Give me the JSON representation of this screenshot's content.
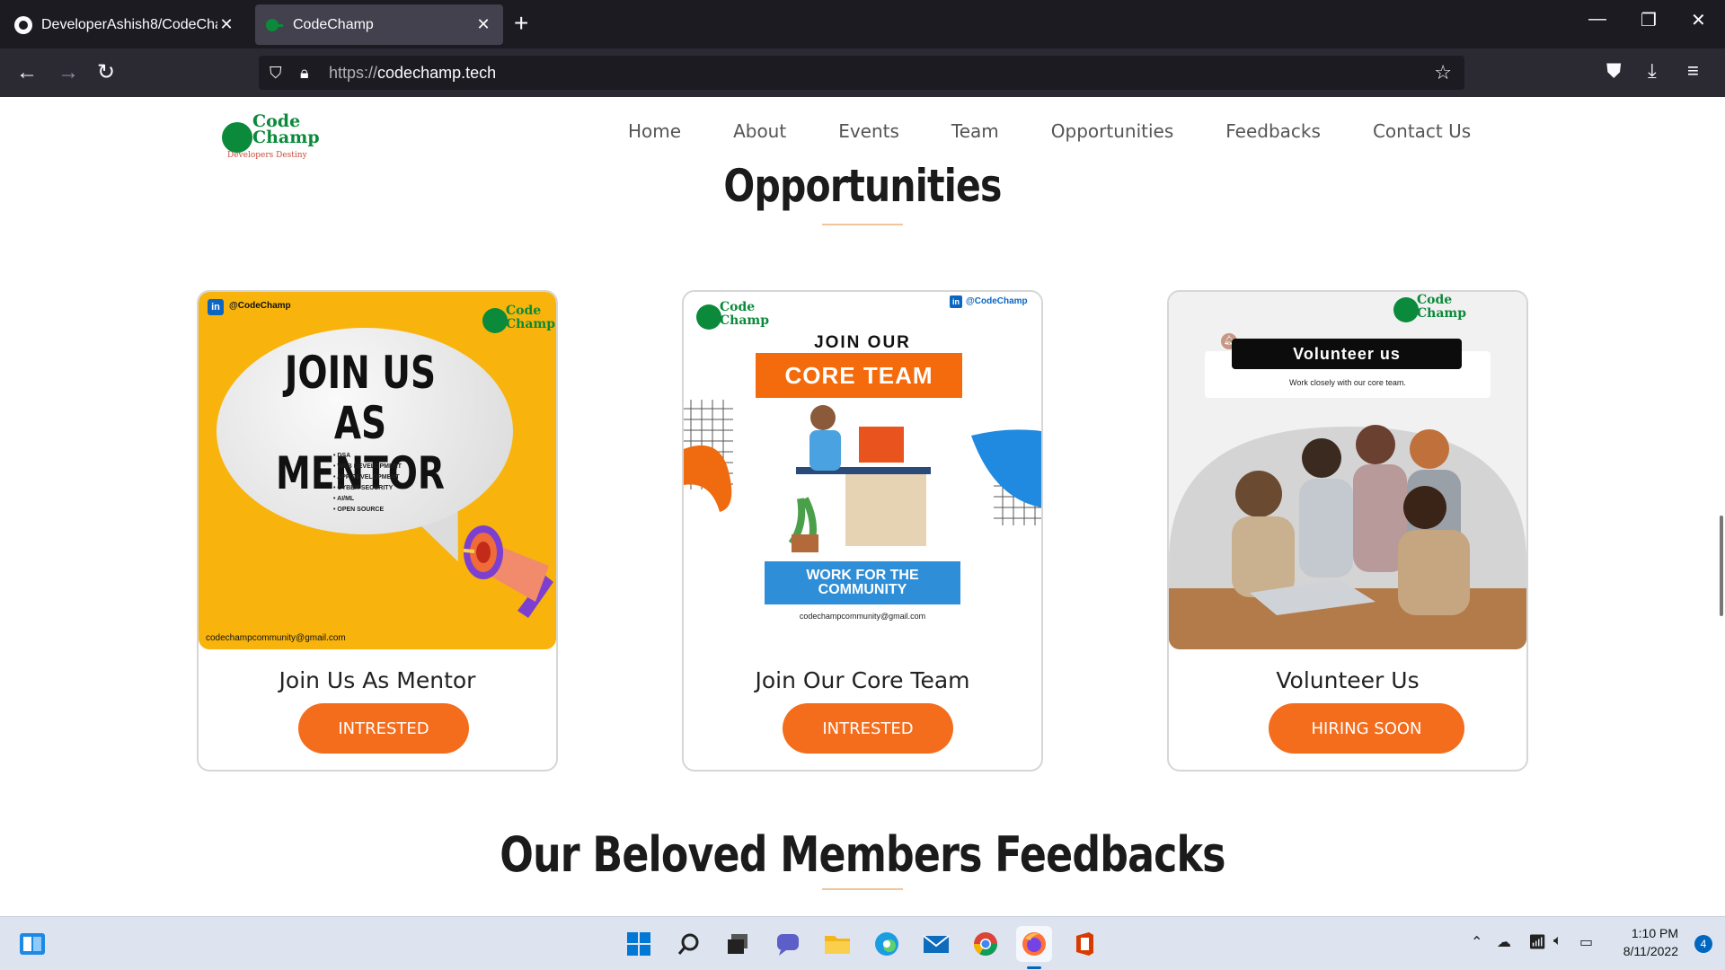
{
  "browser": {
    "tabs": [
      {
        "title": "DeveloperAshish8/CodeChamp",
        "close": "✕",
        "icon": "github-icon"
      },
      {
        "title": "CodeChamp",
        "close": "✕",
        "icon": "codechamp-favicon"
      }
    ],
    "new_tab": "+",
    "url_scheme": "https://",
    "url_host": "codechamp.tech",
    "window_controls": {
      "minimize": "—",
      "restore": "❐",
      "close": "✕"
    }
  },
  "site": {
    "logo": {
      "line1": "Code",
      "line2": "Champ",
      "tagline": "Developers Destiny"
    },
    "nav": [
      "Home",
      "About",
      "Events",
      "Team",
      "Opportunities",
      "Feedbacks",
      "Contact Us"
    ]
  },
  "opportunities": {
    "title": "Opportunities",
    "cards": [
      {
        "title": "Join Us As Mentor",
        "button": "INTRESTED",
        "poster": {
          "handle": "@CodeChamp",
          "headline": "JOIN US AS MENTOR",
          "bullets": [
            "• DSA",
            "• WEB DEVELOPMENT",
            "• APP DEVELOPMENT",
            "• CYBER SECURITY",
            "• AI/ML",
            "• OPEN SOURCE"
          ],
          "email": "codechampcommunity@gmail.com"
        }
      },
      {
        "title": "Join Our Core Team",
        "button": "INTRESTED",
        "poster": {
          "handle": "@CodeChamp",
          "join": "JOIN OUR",
          "core": "CORE TEAM",
          "work": "WORK FOR THE COMMUNITY",
          "email": "codechampcommunity@gmail.com"
        }
      },
      {
        "title": "Volunteer Us",
        "button": "HIRING SOON",
        "poster": {
          "heading": "Volunteer us",
          "sub": "Work closely with our core team."
        }
      }
    ]
  },
  "feedbacks": {
    "title": "Our Beloved Members Feedbacks"
  },
  "taskbar": {
    "time": "1:10 PM",
    "date": "8/11/2022",
    "notifications": "4"
  },
  "colors": {
    "accent_button": "#f46d1c",
    "brand_green": "#0a8a3a",
    "underline": "#f0c59b"
  }
}
